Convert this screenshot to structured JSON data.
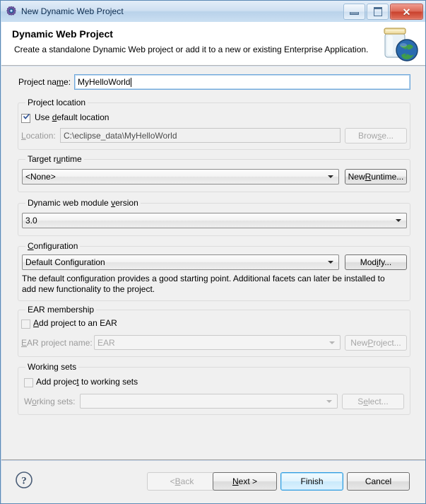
{
  "window": {
    "title": "New Dynamic Web Project",
    "icon": "gear-icon",
    "minimize_tooltip": "Minimize",
    "maximize_tooltip": "Maximize",
    "close_tooltip": "Close"
  },
  "header": {
    "title": "Dynamic Web Project",
    "description": "Create a standalone Dynamic Web project or add it to a new or existing Enterprise Application.",
    "icon": "jar-globe-icon"
  },
  "project_name": {
    "label_pre": "Project na",
    "label_mnemonic": "m",
    "label_post": "e:",
    "value": "MyHelloWorld"
  },
  "project_location": {
    "group_label": "Project location",
    "use_default": {
      "label_pre": "Use ",
      "label_mnemonic": "d",
      "label_post": "efault location",
      "checked": true
    },
    "location": {
      "label_mnemonic": "L",
      "label_post": "ocation:",
      "value": "C:\\eclipse_data\\MyHelloWorld",
      "enabled": false
    },
    "browse_button": {
      "label_pre": "Brow",
      "label_mnemonic": "s",
      "label_post": "e...",
      "enabled": false
    }
  },
  "target_runtime": {
    "group_label_pre": "Target r",
    "group_label_mnemonic": "u",
    "group_label_post": "ntime",
    "selected": "<None>",
    "options": [
      "<None>"
    ],
    "new_runtime_button": {
      "label_pre": "New ",
      "label_mnemonic": "R",
      "label_post": "untime..."
    }
  },
  "module_version": {
    "group_label_pre": "Dynamic web module ",
    "group_label_mnemonic": "v",
    "group_label_post": "ersion",
    "selected": "3.0",
    "options": [
      "3.0"
    ]
  },
  "configuration": {
    "group_label_mnemonic": "C",
    "group_label_post": "onfiguration",
    "selected": "Default Configuration",
    "options": [
      "Default Configuration"
    ],
    "modify_button": {
      "label_pre": "Mod",
      "label_mnemonic": "i",
      "label_post": "fy..."
    },
    "description": "The default configuration provides a good starting point. Additional facets can later be installed to add new functionality to the project."
  },
  "ear_membership": {
    "group_label": "EAR membership",
    "add_to_ear": {
      "label_mnemonic": "A",
      "label_post": "dd project to an EAR",
      "checked": false
    },
    "ear_project_name": {
      "label_mnemonic": "E",
      "label_post": "AR project name:",
      "value": "EAR",
      "enabled": false
    },
    "new_project_button": {
      "label_pre": "New ",
      "label_mnemonic": "P",
      "label_post": "roject...",
      "enabled": false
    }
  },
  "working_sets": {
    "group_label": "Working sets",
    "add_to_working_sets": {
      "label_pre": "Add projec",
      "label_mnemonic": "t",
      "label_post": " to working sets",
      "checked": false
    },
    "working_sets_field": {
      "label_pre": "W",
      "label_mnemonic": "o",
      "label_post": "rking sets:",
      "value": "",
      "enabled": false
    },
    "select_button": {
      "label_pre": "S",
      "label_mnemonic": "e",
      "label_post": "lect...",
      "enabled": false
    }
  },
  "footer": {
    "help_icon": "question-mark-icon",
    "back_button": {
      "label_pre": "< ",
      "label_mnemonic": "B",
      "label_post": "ack",
      "enabled": false
    },
    "next_button": {
      "label_pre": "",
      "label_mnemonic": "N",
      "label_post": "ext >",
      "enabled": true
    },
    "finish_button": {
      "label": "Finish",
      "is_default": true
    },
    "cancel_button": {
      "label": "Cancel"
    }
  },
  "colors": {
    "accent": "#2e9ce0",
    "title_text": "#0a2a4d",
    "disabled_text": "#9a9a9a",
    "close_button": "#c9412d"
  }
}
